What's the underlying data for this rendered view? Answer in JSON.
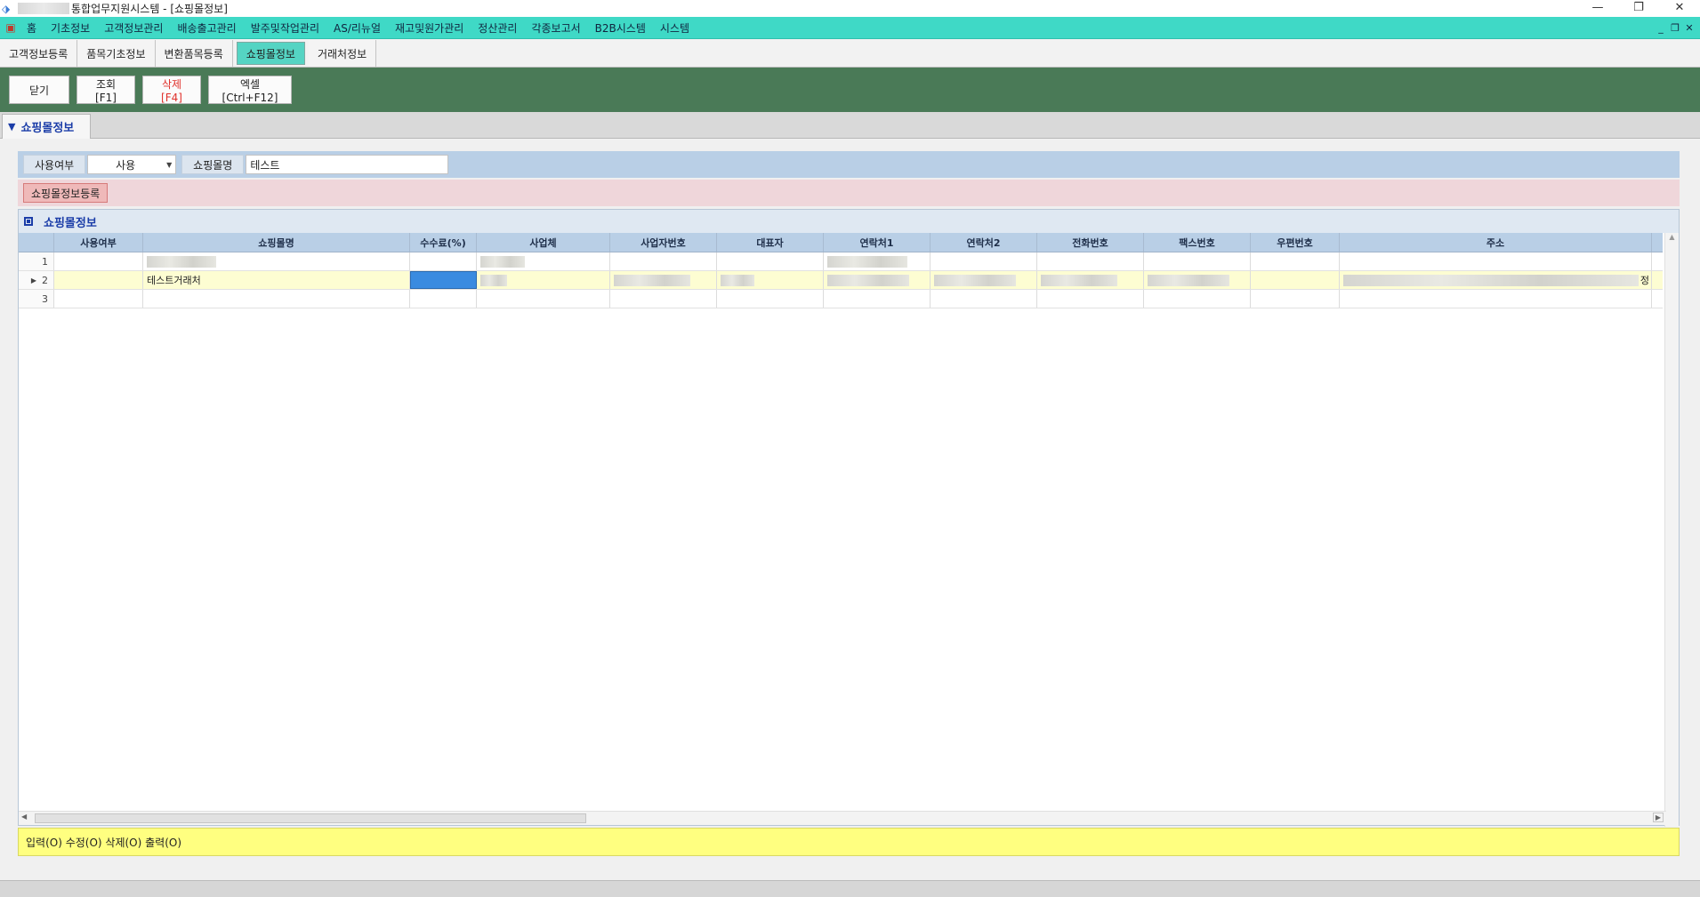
{
  "window": {
    "title": "통합업무지원시스템 - [쇼핑몰정보]",
    "controls": [
      "—",
      "❐",
      "✕"
    ]
  },
  "menubar": {
    "items": [
      "홈",
      "기초정보",
      "고객정보관리",
      "배송출고관리",
      "발주및작업관리",
      "AS/리뉴얼",
      "재고및원가관리",
      "정산관리",
      "각종보고서",
      "B2B시스템",
      "시스템"
    ],
    "mdi_controls": [
      "_",
      "❐",
      "✕"
    ]
  },
  "tabs": [
    {
      "label": "고객정보등록",
      "active": false
    },
    {
      "label": "품목기초정보",
      "active": false
    },
    {
      "label": "변환품목등록",
      "active": false
    },
    {
      "label": "쇼핑몰정보",
      "active": true
    },
    {
      "label": "거래처정보",
      "active": false
    }
  ],
  "toolbar": {
    "close_label": "닫기",
    "search_label": "조회[F1]",
    "delete_label": "삭제[F4]",
    "excel_label": "엑셀[Ctrl+F12]"
  },
  "section": {
    "title": "쇼핑몰정보"
  },
  "search": {
    "use_label": "사용여부",
    "use_value": "사용",
    "mall_label": "쇼핑몰명",
    "mall_value": "테스트"
  },
  "register": {
    "button_label": "쇼핑몰정보등록"
  },
  "grid": {
    "caption": "쇼핑몰정보",
    "columns": [
      "사용여부",
      "쇼핑몰명",
      "수수료(%)",
      "사업체",
      "사업자번호",
      "대표자",
      "연락처1",
      "연락처2",
      "전화번호",
      "팩스번호",
      "우편번호",
      "주소"
    ],
    "rows": [
      {
        "num": "1",
        "mall_name": ""
      },
      {
        "num": "2",
        "mall_name": "테스트거래처",
        "addr_tail": "정"
      },
      {
        "num": "3",
        "mall_name": ""
      }
    ]
  },
  "status": {
    "text": "입력(O) 수정(O) 삭제(O) 출력(O)"
  },
  "colors": {
    "menubar": "#3fd9c6",
    "toolbar": "#4a7a57",
    "active_tab": "#55d4c3",
    "status_bar": "#ffff80",
    "danger_text": "#e0312b",
    "focus_cell": "#3a8be0"
  }
}
